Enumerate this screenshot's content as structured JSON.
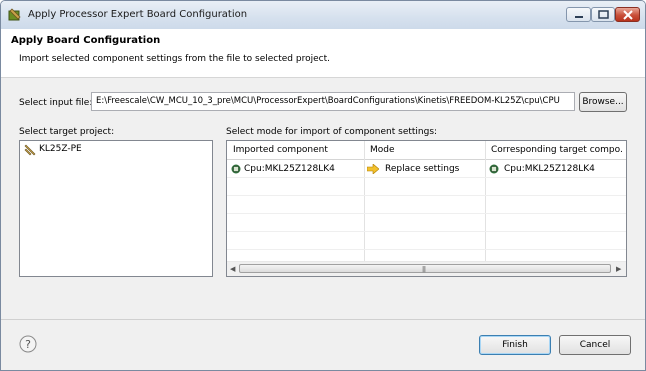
{
  "window": {
    "title": "Apply Processor Expert Board Configuration"
  },
  "header": {
    "title": "Apply Board Configuration",
    "description": "Import selected component settings from the file to selected project."
  },
  "input_file": {
    "label": "Select input file:",
    "value": "E:\\Freescale\\CW_MCU_10_3_pre\\MCU\\ProcessorExpert\\BoardConfigurations\\Kinetis\\FREEDOM-KL25Z\\cpu\\CPU",
    "browse_label": "Browse..."
  },
  "target_project": {
    "label": "Select target project:",
    "items": [
      "KL25Z-PE"
    ]
  },
  "mode_table": {
    "label": "Select mode for import of component settings:",
    "columns": [
      "Imported component",
      "Mode",
      "Corresponding target compo..."
    ],
    "rows": [
      {
        "imported": "Cpu:MKL25Z128LK4",
        "mode": "Replace settings",
        "target": "Cpu:MKL25Z128LK4"
      }
    ]
  },
  "footer": {
    "finish_label": "Finish",
    "cancel_label": "Cancel"
  },
  "colors": {
    "accent": "#3c7fb1",
    "mode_arrow": "#e8a400",
    "chip": "#2f6f3a"
  }
}
